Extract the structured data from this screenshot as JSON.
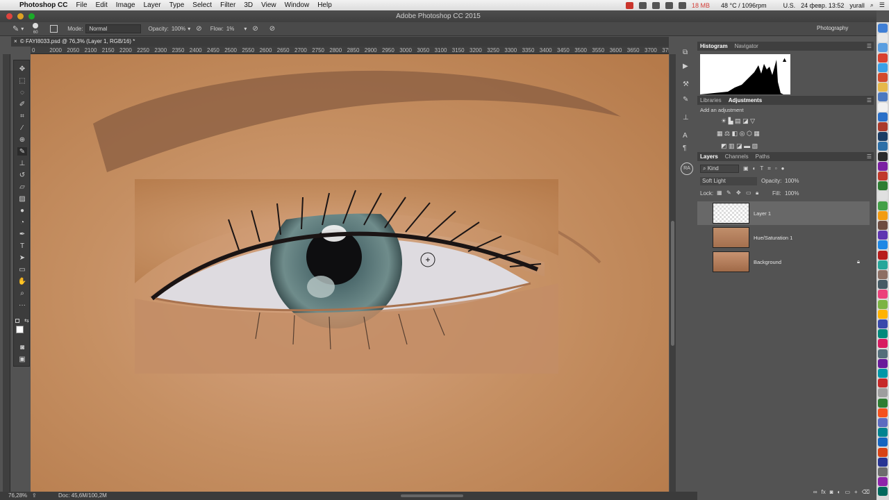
{
  "menubar": {
    "app": "Photoshop CC",
    "items": [
      "File",
      "Edit",
      "Image",
      "Layer",
      "Type",
      "Select",
      "Filter",
      "3D",
      "View",
      "Window",
      "Help"
    ],
    "memory": "18 MB",
    "temp": "48 °C / 1096rpm",
    "lang": "U.S.",
    "datetime": "24 февр. 13:52",
    "user": "yurall"
  },
  "window": {
    "title": "Adobe Photoshop CC 2015"
  },
  "options": {
    "brush_size": "60",
    "mode_label": "Mode:",
    "mode_value": "Normal",
    "opacity_label": "Opacity:",
    "opacity_value": "100%",
    "flow_label": "Flow:",
    "flow_value": "1%",
    "workspace": "Photography"
  },
  "document": {
    "tab": "© FAYI8033.psd @ 76,3% (Layer 1, RGB/16) *",
    "ruler_ticks": [
      "0",
      "2000",
      "2050",
      "2100",
      "2150",
      "2200",
      "2250",
      "2300",
      "2350",
      "2400",
      "2450",
      "2500",
      "2550",
      "2600",
      "2650",
      "2700",
      "2750",
      "2800",
      "2850",
      "2900",
      "2950",
      "3000",
      "3050",
      "3100",
      "3150",
      "3200",
      "3250",
      "3300",
      "3350",
      "3400",
      "3450",
      "3500",
      "3550",
      "3600",
      "3650",
      "3700",
      "375"
    ]
  },
  "status": {
    "zoom": "76,28%",
    "doc": "Doc: 45,6M/100,2M"
  },
  "panels": {
    "top_tabs": [
      "Histogram",
      "Navigator"
    ],
    "mid_tabs": [
      "Libraries",
      "Adjustments"
    ],
    "add_adjustment": "Add an adjustment",
    "layer_tabs": [
      "Layers",
      "Channels",
      "Paths"
    ],
    "filter_kind": "Kind",
    "blend_mode": "Soft Light",
    "opacity_label": "Opacity:",
    "opacity_value": "100%",
    "lock_label": "Lock:",
    "fill_label": "Fill:",
    "fill_value": "100%",
    "user_badge": "RA",
    "layers": [
      {
        "name": "Layer 1"
      },
      {
        "name": "Hue/Saturation 1"
      },
      {
        "name": "Background"
      }
    ]
  },
  "colors": {
    "accent": "#6f6f6f"
  }
}
